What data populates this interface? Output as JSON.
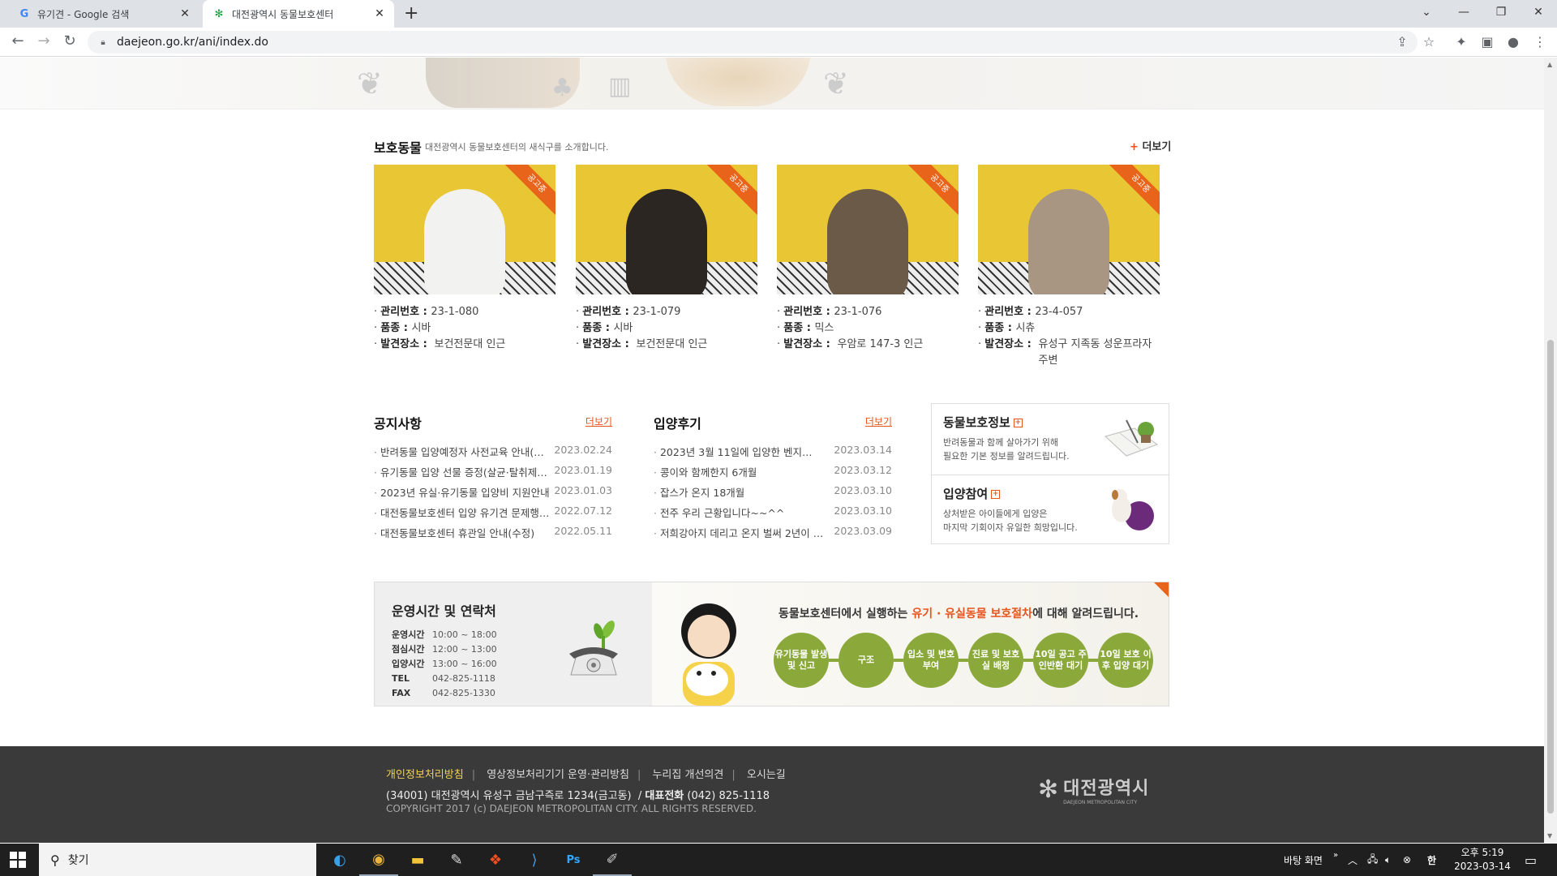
{
  "browser": {
    "tabs": [
      {
        "title": "유기견 - Google 검색",
        "active": false
      },
      {
        "title": "대전광역시 동물보호센터",
        "active": true
      }
    ],
    "url": "daejeon.go.kr/ani/index.do"
  },
  "protected": {
    "title": "보호동물",
    "subtitle": "대전광역시 동물보호센터의 새식구를 소개합니다.",
    "more": "더보기",
    "badge": "공고중",
    "labels": {
      "id": "관리번호",
      "breed": "품종",
      "place": "발견장소"
    },
    "animals": [
      {
        "id": "23-1-080",
        "breed": "시바",
        "place": "보건전문대 인근",
        "dog_color": "#f2f2f0"
      },
      {
        "id": "23-1-079",
        "breed": "시바",
        "place": "보건전문대 인근",
        "dog_color": "#2b2622"
      },
      {
        "id": "23-1-076",
        "breed": "믹스",
        "place": "우암로 147-3 인근",
        "dog_color": "#6b5a48"
      },
      {
        "id": "23-4-057",
        "breed": "시츄",
        "place": "유성구 지족동 성운프라자 주변",
        "dog_color": "#a89582"
      }
    ]
  },
  "notice": {
    "title": "공지사항",
    "more": "더보기",
    "items": [
      {
        "text": "반려동물 입양예정자 사전교육 안내(필수)",
        "date": "2023.02.24"
      },
      {
        "text": "유기동물 입양 선물 증정(살균·탈취제…",
        "date": "2023.01.19"
      },
      {
        "text": "2023년 유실·유기동물 입양비 지원안내",
        "date": "2023.01.03"
      },
      {
        "text": "대전동물보호센터 입양 유기견 문제행동…",
        "date": "2022.07.12"
      },
      {
        "text": "대전동물보호센터 휴관일 안내(수정)",
        "date": "2022.05.11"
      }
    ]
  },
  "review": {
    "title": "입양후기",
    "more": "더보기",
    "items": [
      {
        "text": "2023년 3월 11일에 입양한 벤지…",
        "date": "2023.03.14"
      },
      {
        "text": "콩이와 함께한지 6개월",
        "date": "2023.03.12"
      },
      {
        "text": "잡스가 온지 18개월",
        "date": "2023.03.10"
      },
      {
        "text": "전주 우리 근황입니다~~^^",
        "date": "2023.03.10"
      },
      {
        "text": "저희강아지 데리고 온지 벌써 2년이 …",
        "date": "2023.03.09"
      }
    ]
  },
  "info": {
    "protect": {
      "title": "동물보호정보",
      "desc1": "반려동물과 함께 살아가기 위해",
      "desc2": "필요한 기본 정보를 알려드립니다."
    },
    "adopt": {
      "title": "입양참여",
      "desc1": "상처받은 아이들에게 입양은",
      "desc2": "마지막 기회이자 유일한 희망입니다."
    }
  },
  "hours": {
    "title": "운영시간 및 연락처",
    "rows": [
      {
        "k": "운영시간",
        "v": "10:00 ~ 18:00"
      },
      {
        "k": "점심시간",
        "v": "12:00 ~ 13:00"
      },
      {
        "k": "입양시간",
        "v": "13:00 ~ 16:00"
      },
      {
        "k": "TEL",
        "v": "042-825-1118"
      },
      {
        "k": "FAX",
        "v": "042-825-1330"
      }
    ],
    "msg_pre": "동물보호센터에서 실행하는",
    "msg_hl": "유기 · 유실동물 보호절차",
    "msg_post": "에 대해 알려드립니다.",
    "steps": [
      "유기동물 발생 및 신고",
      "구조",
      "입소 및 번호부여",
      "진료 및 보호실 배정",
      "10일 공고 주인반환 대기",
      "10일 보호 이후 입양 대기"
    ]
  },
  "footer": {
    "links": [
      "개인정보처리방침",
      "영상정보처리기기 운영·관리방침",
      "누리집 개선의견",
      "오시는길"
    ],
    "address": "(34001) 대전광역시 유성구 금남구즉로 1234(금고동)",
    "phone_label": "대표전화",
    "phone": "(042) 825-1118",
    "copyright": "COPYRIGHT 2017 (c) DAEJEON METROPOLITAN CITY. ALL RIGHTS RESERVED.",
    "logo": "대전광역시",
    "logo_en": "DAEJEON METROPOLITAN CITY"
  },
  "taskbar": {
    "search_placeholder": "찾기",
    "desktop": "바탕 화면",
    "time": "오후 5:19",
    "date": "2023-03-14"
  }
}
